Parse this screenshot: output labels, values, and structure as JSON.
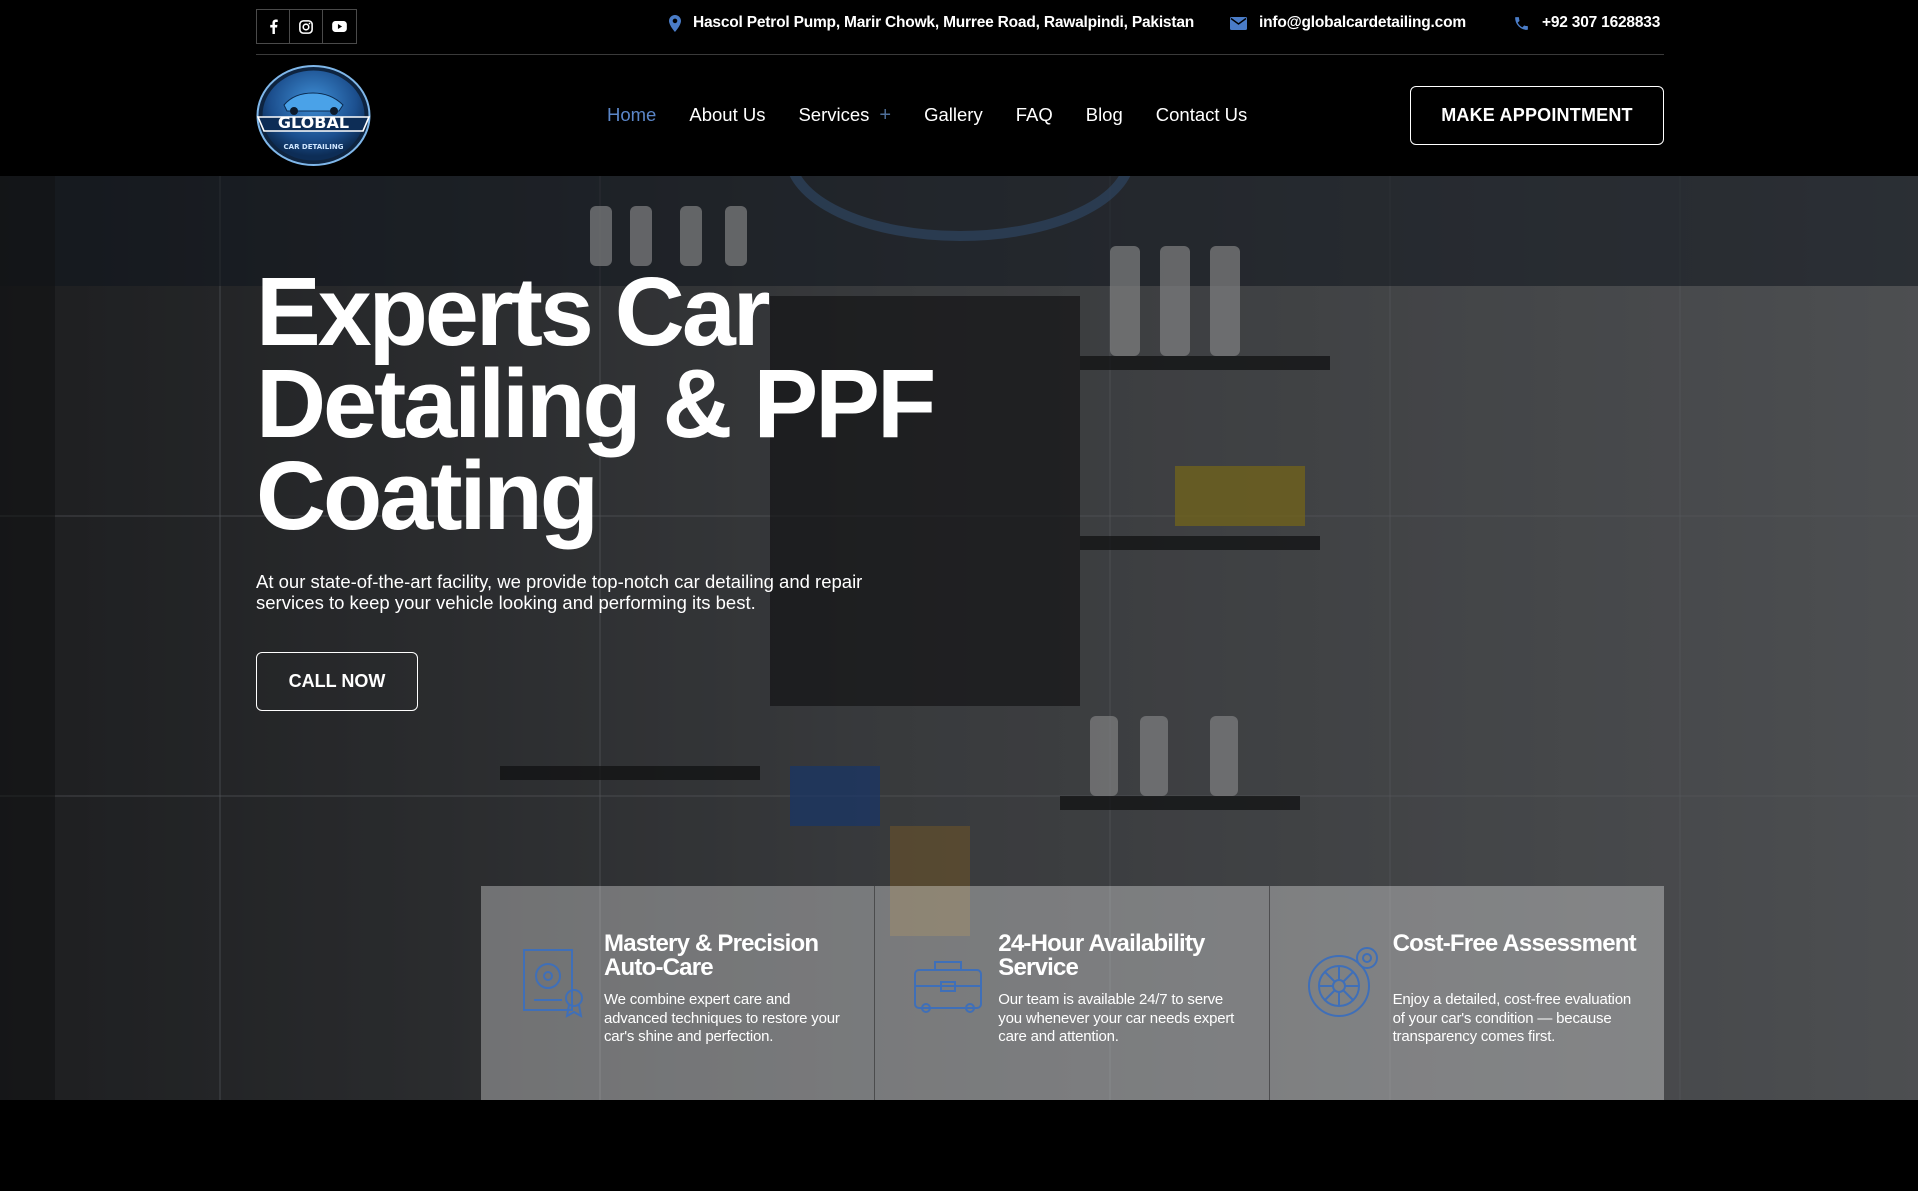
{
  "topbar": {
    "socials": [
      {
        "icon": "facebook-icon"
      },
      {
        "icon": "instagram-icon"
      },
      {
        "icon": "youtube-icon"
      }
    ],
    "address": "Hascol Petrol Pump, Marir Chowk, Murree Road, Rawalpindi, Pakistan",
    "email": "info@globalcardetailing.com",
    "phone": "+92 307 1628833"
  },
  "logo": {
    "text": "GLOBAL",
    "subtext": "CAR DETAILING"
  },
  "nav": {
    "items": [
      "Home",
      "About Us",
      "Services",
      "Gallery",
      "FAQ",
      "Blog",
      "Contact Us"
    ],
    "services_expander": "+",
    "appointment": "MAKE APPOINTMENT"
  },
  "hero": {
    "headline_1": "Experts Car",
    "headline_2": "Detailing & PPF",
    "headline_3": "Coating",
    "subtitle": "At our state-of-the-art facility, we provide top-notch car detailing and repair services to keep your vehicle looking and performing its best.",
    "cta": "CALL NOW"
  },
  "features": [
    {
      "icon": "certificate-icon",
      "title": "Mastery & Precision Auto-Care",
      "desc": "We combine expert care and advanced techniques to restore your car's shine and perfection."
    },
    {
      "icon": "toolbox-icon",
      "title": "24-Hour Availability Service",
      "desc": "Our team is available 24/7 to serve you whenever your car needs expert care and attention."
    },
    {
      "icon": "wheel-icon",
      "title": "Cost-Free Assessment",
      "desc": "Enjoy a detailed, cost-free evaluation of your car's condition — because transparency comes first."
    }
  ],
  "colors": {
    "accent": "#5b86c8",
    "icon": "#3f6fb8",
    "background": "#000000"
  }
}
